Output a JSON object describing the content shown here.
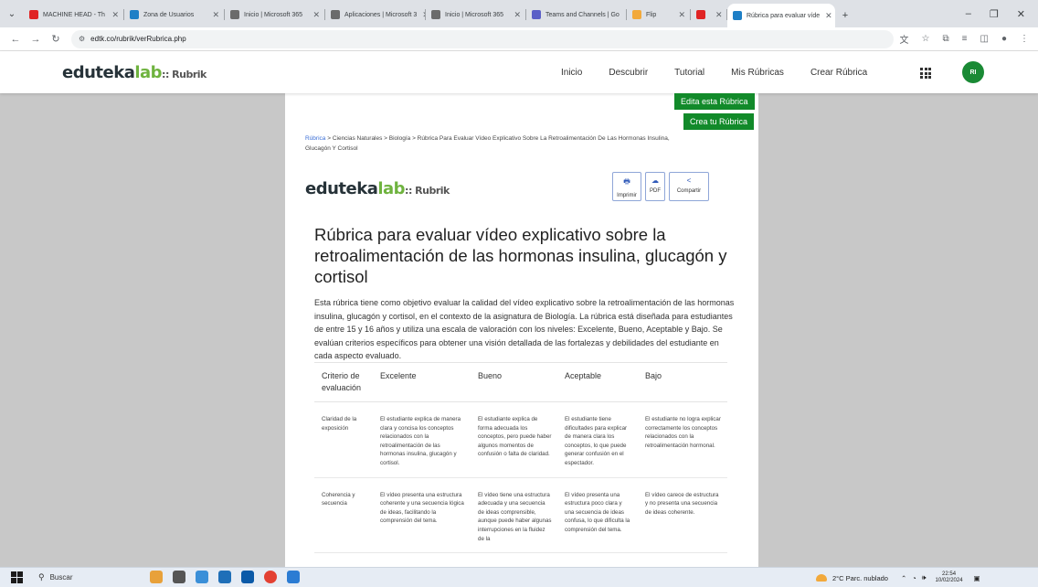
{
  "browser": {
    "tabs": [
      {
        "title": "MACHINE HEAD - Th",
        "color": "#e02424",
        "active": false
      },
      {
        "title": "Zona de Usuarios",
        "color": "#1e7fc6",
        "active": false
      },
      {
        "title": "Inicio | Microsoft 365",
        "color": "#6b6b6b",
        "active": false
      },
      {
        "title": "Aplicaciones | Microsoft 3",
        "color": "#6b6b6b",
        "active": false
      },
      {
        "title": "Inicio | Microsoft 365",
        "color": "#6b6b6b",
        "active": false
      },
      {
        "title": "Teams and Channels | Go",
        "color": "#5b5fc7",
        "active": false
      },
      {
        "title": "Flip",
        "color": "#f2a93b",
        "active": false
      },
      {
        "title": "",
        "color": "#e02424",
        "active": false
      },
      {
        "title": "Rúbrica para evaluar víde",
        "color": "#1e7fc6",
        "active": true
      }
    ],
    "new_tab": "+",
    "url": "edtk.co/rubrik/verRubrica.php"
  },
  "site": {
    "logo_part1": "eduteka",
    "logo_part2": "lab",
    "logo_part3": ":: Rubrik",
    "nav": [
      "Inicio",
      "Descubrir",
      "Tutorial",
      "Mis Rúbricas",
      "Crear Rúbrica"
    ],
    "avatar": "RI",
    "edit_button": "Edita esta Rúbrica",
    "create_button": "Crea tu Rúbrica"
  },
  "page": {
    "breadcrumb_first": "Rúbrica",
    "breadcrumb_rest": " > Ciencias Naturales > Biología > Rúbrica Para Evaluar Vídeo Explicativo Sobre La Retroalimentación De Las Hormonas Insulina, Glucagón Y Cortisol",
    "actions": [
      {
        "label": "Imprimir",
        "icon": "printer-icon",
        "glyph": "🖶"
      },
      {
        "label": "PDF",
        "icon": "pdf-icon",
        "glyph": "☁"
      },
      {
        "label": "Compartir",
        "icon": "share-icon",
        "glyph": "<"
      }
    ],
    "title": "Rúbrica para evaluar vídeo explicativo sobre la retroalimentación de las hormonas insulina, glucagón y cortisol",
    "description": "Esta rúbrica tiene como objetivo evaluar la calidad del vídeo explicativo sobre la retroalimentación de las hormonas insulina, glucagón y cortisol, en el contexto de la asignatura de Biología. La rúbrica está diseñada para estudiantes de entre 15 y 16 años y utiliza una escala de valoración con los niveles: Excelente, Bueno, Aceptable y Bajo. Se evalúan criterios específicos para obtener una visión detallada de las fortalezas y debilidades del estudiante en cada aspecto evaluado.",
    "table": {
      "headers": [
        "Criterio de evaluación",
        "Excelente",
        "Bueno",
        "Aceptable",
        "Bajo"
      ],
      "rows": [
        [
          "Claridad de la exposición",
          "El estudiante explica de manera clara y concisa los conceptos relacionados con la retroalimentación de las hormonas insulina, glucagón y cortisol.",
          "El estudiante explica de forma adecuada los conceptos, pero puede haber algunos momentos de confusión o falta de claridad.",
          "El estudiante tiene dificultades para explicar de manera clara los conceptos, lo que puede generar confusión en el espectador.",
          "El estudiante no logra explicar correctamente los conceptos relacionados con la retroalimentación hormonal."
        ],
        [
          "Coherencia y secuencia",
          "El vídeo presenta una estructura coherente y una secuencia lógica de ideas, facilitando la comprensión del tema.",
          "El vídeo tiene una estructura adecuada y una secuencia de ideas comprensible, aunque puede haber algunas interrupciones en la fluidez de la",
          "El vídeo presenta una estructura poco clara y una secuencia de ideas confusa, lo que dificulta la comprensión del tema.",
          "El vídeo carece de estructura y no presenta una secuencia de ideas coherente."
        ]
      ]
    }
  },
  "taskbar": {
    "search": "Buscar",
    "weather": "2°C  Parc. nublado",
    "time": "22:54",
    "date": "10/02/2024"
  }
}
